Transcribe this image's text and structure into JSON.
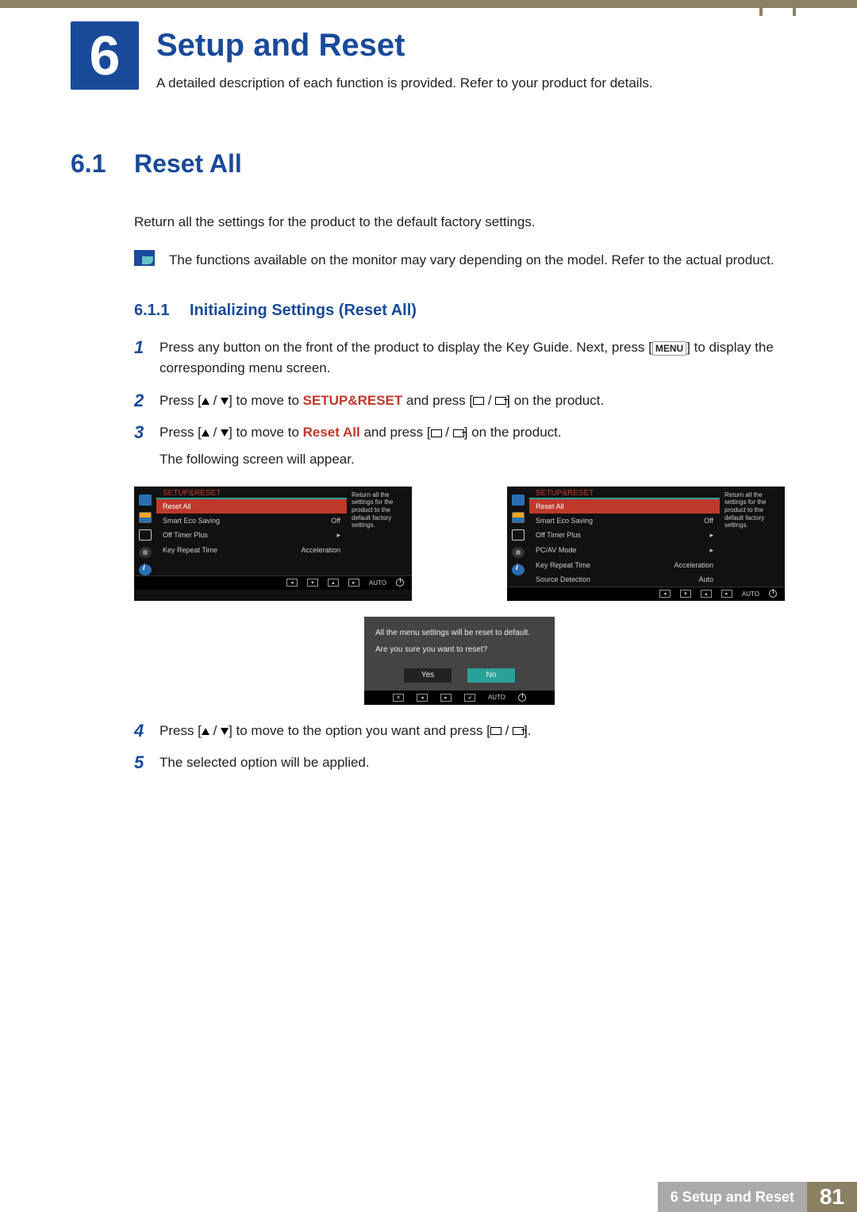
{
  "chapter": {
    "num": "6",
    "title": "Setup and Reset",
    "subtitle": "A detailed description of each function is provided. Refer to your product for details."
  },
  "section": {
    "num": "6.1",
    "title": "Reset All",
    "intro": "Return all the settings for the product to the default factory settings.",
    "note": "The functions available on the monitor may vary depending on the model. Refer to the actual product."
  },
  "subsection": {
    "num": "6.1.1",
    "title": "Initializing Settings (Reset All)"
  },
  "steps": {
    "s1_pre": "Press any button on the front of the product to display the Key Guide. Next, press [",
    "s1_kbd": "MENU",
    "s1_post": "] to display the corresponding menu screen.",
    "s2_a": "Press [",
    "s2_b": "] to move to ",
    "s2_target": "SETUP&RESET",
    "s2_c": " and press [",
    "s2_d": "] on the product.",
    "s3_a": "Press [",
    "s3_b": "] to move to ",
    "s3_target": "Reset All",
    "s3_c": " and press [",
    "s3_d": "] on the product.",
    "s3_e": "The following screen will appear.",
    "s4_a": "Press [",
    "s4_b": "] to move to the option you want and press [",
    "s4_c": "].",
    "s5": "The selected option will be applied."
  },
  "osd_left": {
    "header": "SETUP&RESET",
    "desc": "Return all the settings for the product to the default factory settings.",
    "items": [
      {
        "label": "Reset All",
        "value": "",
        "sel": true
      },
      {
        "label": "Smart Eco Saving",
        "value": "Off"
      },
      {
        "label": "Off Timer Plus",
        "value": "▸"
      },
      {
        "label": "Key Repeat Time",
        "value": "Acceleration"
      }
    ],
    "auto": "AUTO"
  },
  "osd_right": {
    "header": "SETUP&RESET",
    "desc": "Return all the settings for the product to the default factory settings.",
    "items": [
      {
        "label": "Reset All",
        "value": "",
        "sel": true
      },
      {
        "label": "Smart Eco Saving",
        "value": "Off"
      },
      {
        "label": "Off Timer Plus",
        "value": "▸"
      },
      {
        "label": "PC/AV Mode",
        "value": "▸"
      },
      {
        "label": "Key Repeat Time",
        "value": "Acceleration"
      },
      {
        "label": "Source Detection",
        "value": "Auto"
      }
    ],
    "auto": "AUTO"
  },
  "confirm": {
    "msg1": "All the menu settings will be reset to default.",
    "msg2": "Are you sure you want to reset?",
    "yes": "Yes",
    "no": "No",
    "auto": "AUTO"
  },
  "footer": {
    "label": "6 Setup and Reset",
    "page": "81"
  }
}
